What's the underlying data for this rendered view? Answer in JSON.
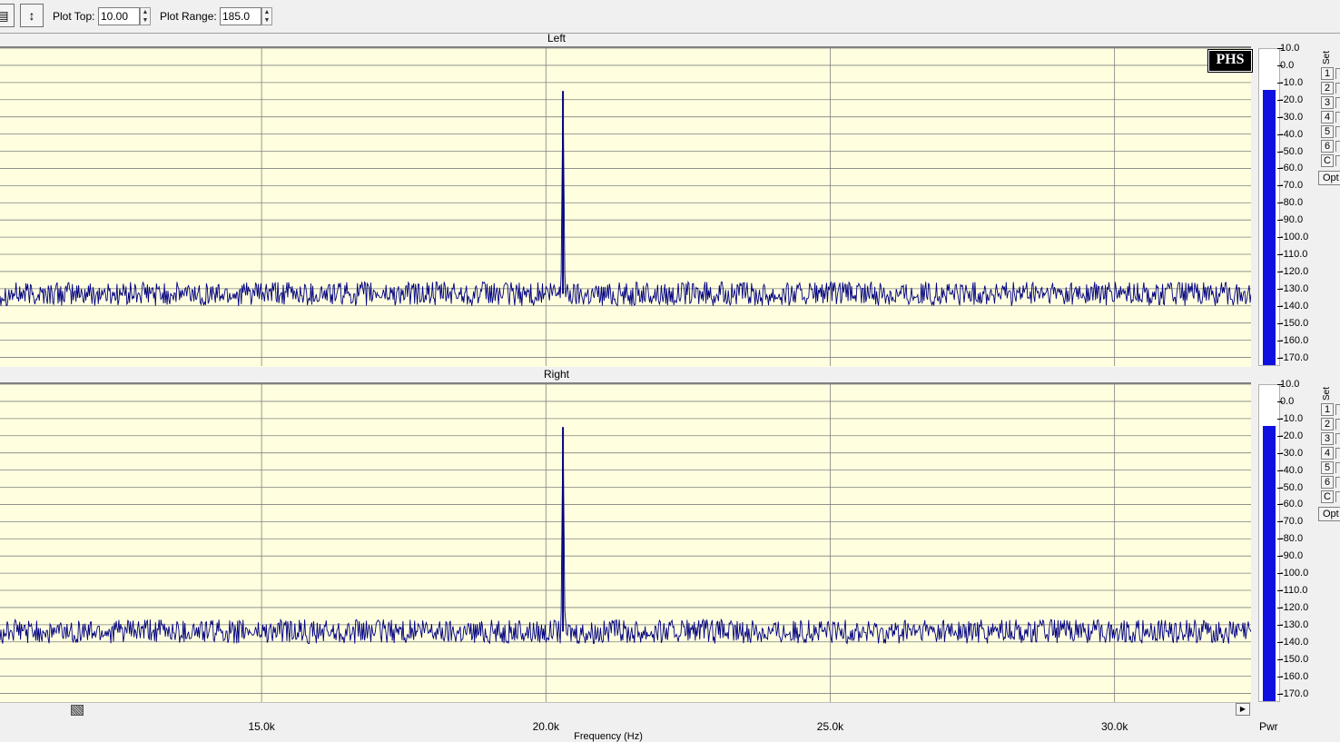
{
  "toolbar": {
    "plot_top_label": "Plot Top:",
    "plot_top_value": "10.00",
    "plot_range_label": "Plot Range:",
    "plot_range_value": "185.0"
  },
  "badge": "PHS",
  "side_panel": {
    "set_label": "Set",
    "set_buttons": [
      "1",
      "2",
      "3",
      "4",
      "5",
      "6",
      "C"
    ],
    "opt_label": "Opt"
  },
  "meter_label": "Pwr",
  "colors": {
    "plot_bg": "#ffffe0",
    "trace": "#000080",
    "meter_fill": "#1010e0",
    "grid": "#808080"
  },
  "chart_data": [
    {
      "type": "line",
      "title": "Left",
      "xlabel": "Frequency (Hz)",
      "ylabel": "",
      "xlim": [
        10400,
        32400
      ],
      "ylim": [
        -175,
        10
      ],
      "x_ticks": [
        15000,
        20000,
        25000,
        30000
      ],
      "x_tick_labels": [
        "15.0k",
        "20.0k",
        "25.0k",
        "30.0k"
      ],
      "y_ticks": [
        10,
        0,
        -10,
        -20,
        -30,
        -40,
        -50,
        -60,
        -70,
        -80,
        -90,
        -100,
        -110,
        -120,
        -130,
        -140,
        -150,
        -160,
        -170
      ],
      "y_tick_labels": [
        "10.0",
        "0.0",
        "-10.0",
        "-20.0",
        "-30.0",
        "-40.0",
        "-50.0",
        "-60.0",
        "-70.0",
        "-80.0",
        "-90.0",
        "-100.0",
        "-110.0",
        "-120.0",
        "-130.0",
        "-140.0",
        "-150.0",
        "-160.0",
        "-170.0"
      ],
      "grid": true,
      "noise_floor_db": -133,
      "peak": {
        "x": 20300,
        "y": -15
      },
      "meter_level_db": -14
    },
    {
      "type": "line",
      "title": "Right",
      "xlabel": "Frequency (Hz)",
      "ylabel": "",
      "xlim": [
        10400,
        32400
      ],
      "ylim": [
        -175,
        10
      ],
      "x_ticks": [
        15000,
        20000,
        25000,
        30000
      ],
      "x_tick_labels": [
        "15.0k",
        "20.0k",
        "25.0k",
        "30.0k"
      ],
      "y_ticks": [
        10,
        0,
        -10,
        -20,
        -30,
        -40,
        -50,
        -60,
        -70,
        -80,
        -90,
        -100,
        -110,
        -120,
        -130,
        -140,
        -150,
        -160,
        -170
      ],
      "y_tick_labels": [
        "10.0",
        "0.0",
        "-10.0",
        "-20.0",
        "-30.0",
        "-40.0",
        "-50.0",
        "-60.0",
        "-70.0",
        "-80.0",
        "-90.0",
        "-100.0",
        "-110.0",
        "-120.0",
        "-130.0",
        "-140.0",
        "-150.0",
        "-160.0",
        "-170.0"
      ],
      "grid": true,
      "noise_floor_db": -134,
      "peak": {
        "x": 20300,
        "y": -15
      },
      "meter_level_db": -14
    }
  ]
}
